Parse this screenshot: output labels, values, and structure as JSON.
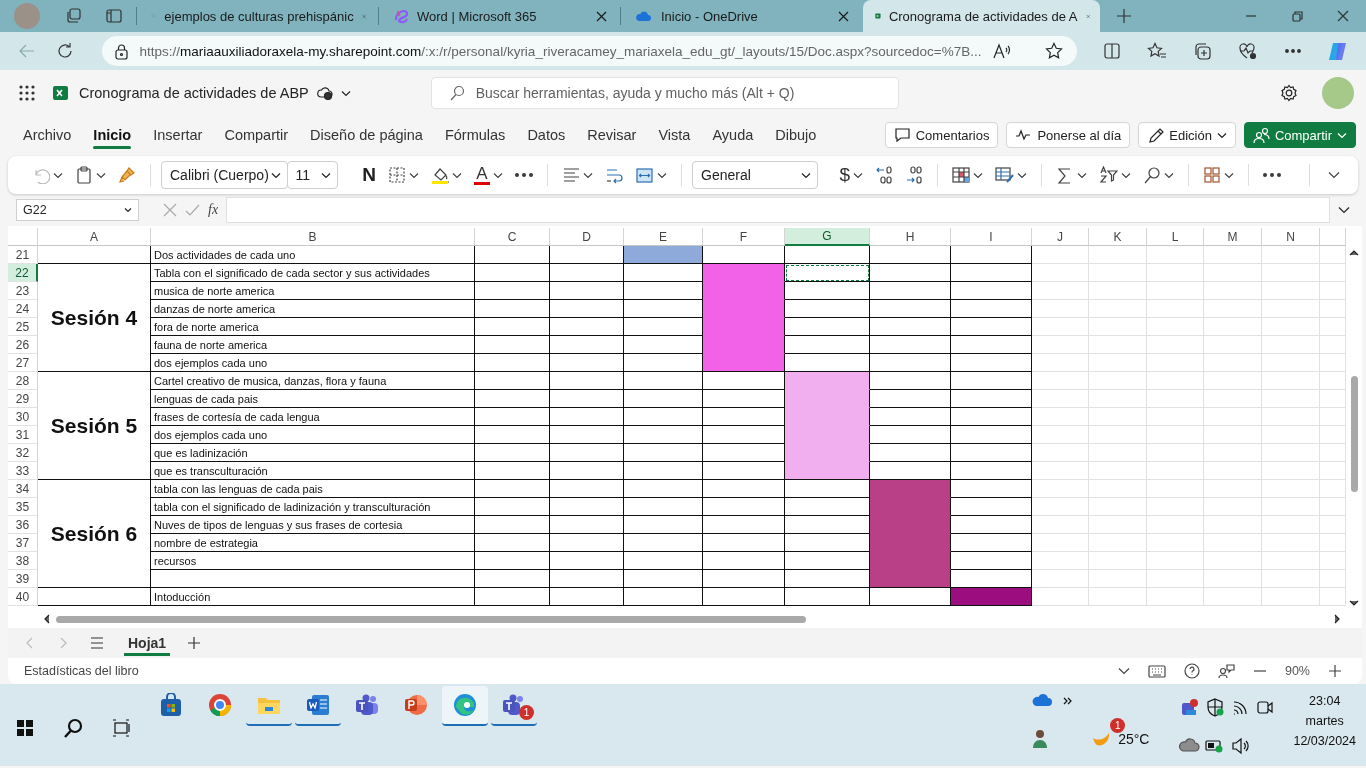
{
  "browser": {
    "tabs": [
      {
        "title": "ejemplos de culturas prehispánic",
        "kind": "search",
        "selected": false
      },
      {
        "title": "Word | Microsoft 365",
        "kind": "m365",
        "selected": false
      },
      {
        "title": "Inicio - OneDrive",
        "kind": "cloud",
        "selected": false
      },
      {
        "title": "Cronograma de actividades de A",
        "kind": "sheet",
        "selected": true
      }
    ],
    "url": {
      "scheme": "https://",
      "host": "mariaauxiliadoraxela-my.sharepoint.com",
      "path": "/:x:/r/personal/kyria_riveracamey_mariaxela_edu_gt/_layouts/15/Doc.aspx?sourcedoc=%7B..."
    }
  },
  "app": {
    "document_title": "Cronograma de actividades de ABP",
    "search_placeholder": "Buscar herramientas, ayuda y mucho más (Alt + Q)"
  },
  "menu": [
    {
      "label": "Archivo",
      "selected": false
    },
    {
      "label": "Inicio",
      "selected": true
    },
    {
      "label": "Insertar",
      "selected": false
    },
    {
      "label": "Compartir",
      "selected": false
    },
    {
      "label": "Diseño de página",
      "selected": false
    },
    {
      "label": "Fórmulas",
      "selected": false
    },
    {
      "label": "Datos",
      "selected": false
    },
    {
      "label": "Revisar",
      "selected": false
    },
    {
      "label": "Vista",
      "selected": false
    },
    {
      "label": "Ayuda",
      "selected": false
    },
    {
      "label": "Dibujo",
      "selected": false
    }
  ],
  "actions": [
    {
      "label": "Comentarios",
      "kind": "comments"
    },
    {
      "label": "Ponerse al día",
      "kind": "catchup"
    },
    {
      "label": "Edición",
      "kind": "mode"
    },
    {
      "label": "Compartir",
      "kind": "share"
    }
  ],
  "ribbon": {
    "font": "Calibri (Cuerpo)",
    "size": "11",
    "bold": "N",
    "font_color": "A",
    "currency": "$",
    "number_format": "General"
  },
  "formula_bar": {
    "name_box": "G22",
    "function": "fx"
  },
  "sheet": {
    "columns": [
      {
        "label": "A",
        "selected": false
      },
      {
        "label": "B",
        "selected": false
      },
      {
        "label": "C",
        "selected": false
      },
      {
        "label": "D",
        "selected": false
      },
      {
        "label": "E",
        "selected": false
      },
      {
        "label": "F",
        "selected": false
      },
      {
        "label": "G",
        "selected": true
      },
      {
        "label": "H",
        "selected": false
      },
      {
        "label": "I",
        "selected": false
      },
      {
        "label": "J",
        "selected": false
      },
      {
        "label": "K",
        "selected": false
      },
      {
        "label": "L",
        "selected": false
      },
      {
        "label": "M",
        "selected": false
      },
      {
        "label": "N",
        "selected": false
      }
    ],
    "blocks": [
      {
        "color": "#8eaadb",
        "rows": [
          {
            "number": "21",
            "selected": false,
            "activity": "Dos actividades de cada uno"
          }
        ]
      },
      {
        "label": "Sesión 4",
        "color": "#f262e8",
        "rows": [
          {
            "number": "22",
            "selected": true,
            "activity": "Tabla con el significado de cada sector y sus actividades"
          },
          {
            "number": "23",
            "selected": false,
            "activity": "musica de norte america"
          },
          {
            "number": "24",
            "selected": false,
            "activity": "danzas de norte america"
          },
          {
            "number": "25",
            "selected": false,
            "activity": "fora de norte america"
          },
          {
            "number": "26",
            "selected": false,
            "activity": "fauna de norte america"
          },
          {
            "number": "27",
            "selected": false,
            "activity": "dos ejemplos cada uno"
          }
        ]
      },
      {
        "label": "Sesión 5",
        "color": "#f2aff0",
        "rows": [
          {
            "number": "28",
            "selected": false,
            "activity": "Cartel creativo de musica, danzas, flora y fauna"
          },
          {
            "number": "29",
            "selected": false,
            "activity": "lenguas de cada pais"
          },
          {
            "number": "30",
            "selected": false,
            "activity": "frases de cortesía de cada lengua"
          },
          {
            "number": "31",
            "selected": false,
            "activity": "dos ejemplos cada uno"
          },
          {
            "number": "32",
            "selected": false,
            "activity": "que es ladinización"
          },
          {
            "number": "33",
            "selected": false,
            "activity": "que es transculturación"
          }
        ]
      },
      {
        "label": "Sesión 6",
        "color": "#b93f86",
        "rows": [
          {
            "number": "34",
            "selected": false,
            "activity": "tabla con las lenguas de cada pais"
          },
          {
            "number": "35",
            "selected": false,
            "activity": "tabla con el significado de ladinización y transculturación"
          },
          {
            "number": "36",
            "selected": false,
            "activity": "Nuves de tipos de lenguas y sus frases de cortesia"
          },
          {
            "number": "37",
            "selected": false,
            "activity": "nombre de estrategia"
          },
          {
            "number": "38",
            "selected": false,
            "activity": "recursos"
          },
          {
            "number": "39",
            "selected": false
          }
        ]
      },
      {
        "color": "#9c0d7f",
        "rows": [
          {
            "number": "40",
            "selected": false,
            "activity": "Intoducción"
          }
        ]
      }
    ]
  },
  "sheet_tabs": [
    {
      "label": "Hoja1",
      "selected": true
    }
  ],
  "status_bar": {
    "text": "Estadísticas del libro",
    "zoom": "90%"
  },
  "taskbar": {
    "teams_badge": "1",
    "weather_badge": "1",
    "temperature": "25°C",
    "time": "23:04",
    "day": "martes",
    "date": "12/03/2024"
  }
}
